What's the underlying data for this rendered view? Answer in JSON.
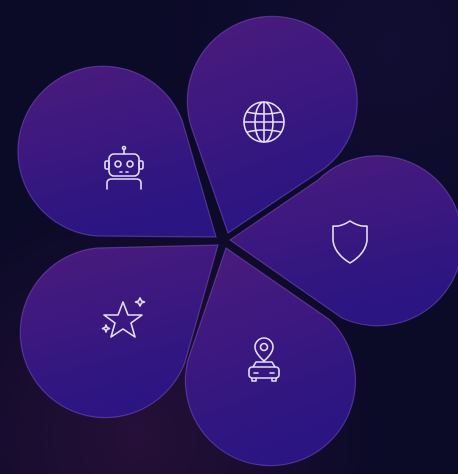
{
  "petals": [
    {
      "id": "globe",
      "icon": "globe-icon"
    },
    {
      "id": "shield",
      "icon": "shield-icon"
    },
    {
      "id": "car-location",
      "icon": "car-location-icon"
    },
    {
      "id": "sparkle-star",
      "icon": "sparkle-star-icon"
    },
    {
      "id": "robot",
      "icon": "robot-icon"
    }
  ],
  "colors": {
    "background": "#0b0a27",
    "petal_top": "#4a1a7a",
    "petal_bottom": "#2a1580",
    "icon": "#e6e0f5"
  }
}
